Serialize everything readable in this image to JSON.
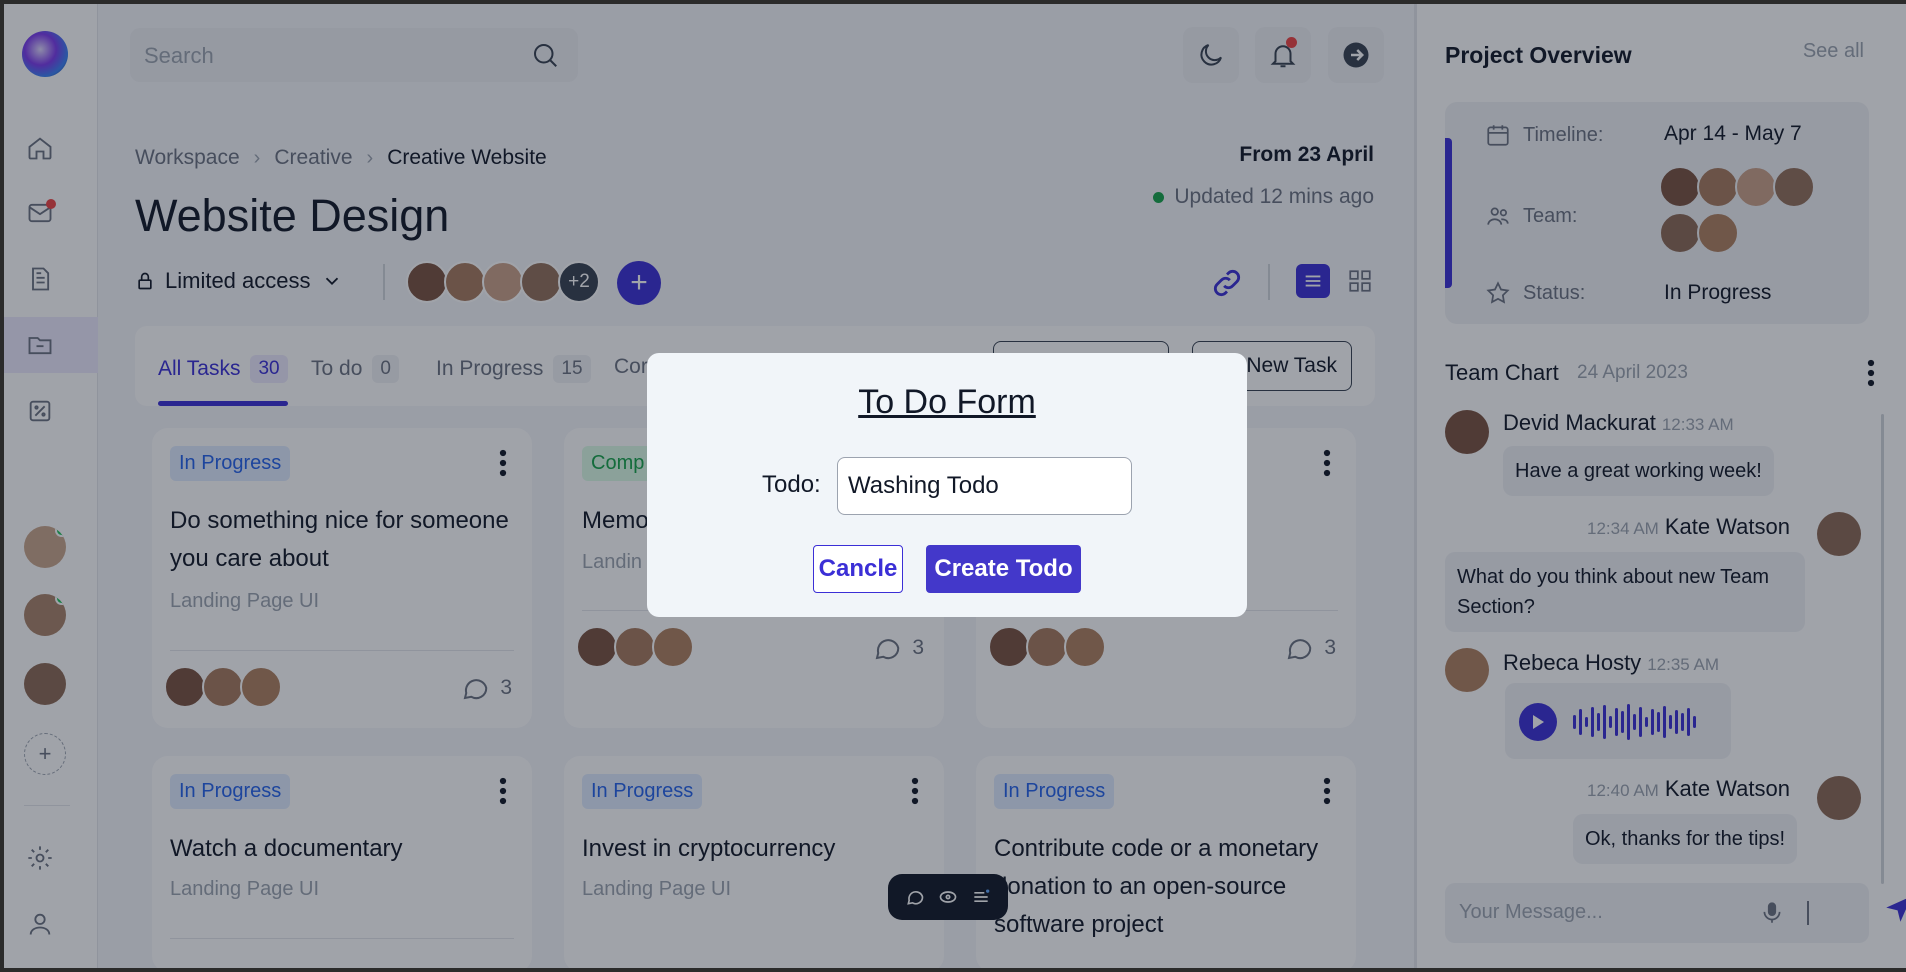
{
  "search": {
    "placeholder": "Search"
  },
  "breadcrumb": {
    "items": [
      "Workspace",
      "Creative",
      "Creative Website"
    ]
  },
  "header": {
    "from_date": "From 23 April",
    "updated": "Updated 12 mins ago",
    "title": "Website Design",
    "access": "Limited access",
    "extra_members": "+2"
  },
  "tabs": [
    {
      "label": "All Tasks",
      "count": "30"
    },
    {
      "label": "To do",
      "count": "0"
    },
    {
      "label": "In Progress",
      "count": "15"
    },
    {
      "label": "Cor",
      "count": ""
    }
  ],
  "toolbar": {
    "new_task": "New Task"
  },
  "cards": [
    {
      "status": "In Progress",
      "title": "Do something nice for someone you care about",
      "subtitle": "Landing Page UI",
      "comments": "3"
    },
    {
      "status": "Comp",
      "title": "Memo",
      "subtitle": "Landin",
      "comments": "3"
    },
    {
      "status": "",
      "title": "",
      "subtitle": "",
      "comments": "3"
    },
    {
      "status": "In Progress",
      "title": "Watch a documentary",
      "subtitle": "Landing Page UI",
      "comments": ""
    },
    {
      "status": "In Progress",
      "title": "Invest in cryptocurrency",
      "subtitle": "Landing Page UI",
      "comments": ""
    },
    {
      "status": "In Progress",
      "title": "Contribute code or a monetary donation to an open-source software project",
      "subtitle": "",
      "comments": ""
    }
  ],
  "overview": {
    "title": "Project Overview",
    "see_all": "See all",
    "timeline_label": "Timeline:",
    "timeline_value": "Apr 14 - May 7",
    "team_label": "Team:",
    "status_label": "Status:",
    "status_value": "In Progress"
  },
  "team_chart": {
    "title": "Team Chart",
    "date": "24 April 2023",
    "messages": [
      {
        "name": "Devid Mackurat",
        "time": "12:33 AM",
        "text": "Have a great working week!"
      },
      {
        "name": "Kate Watson",
        "time": "12:34 AM",
        "text": "What do you think about new Team Section?"
      },
      {
        "name": "Rebeca Hosty",
        "time": "12:35 AM",
        "text": ""
      },
      {
        "name": "Kate Watson",
        "time": "12:40 AM",
        "text": "Ok, thanks for the tips!"
      }
    ],
    "message_placeholder": "Your Message..."
  },
  "modal": {
    "title": "To Do Form",
    "label": "Todo:",
    "input_value": "Washing Todo",
    "cancel": "Cancle",
    "create": "Create Todo"
  },
  "colors": {
    "accent": "#3b2fd6",
    "online": "#22c55e",
    "notification": "#ef4444"
  }
}
